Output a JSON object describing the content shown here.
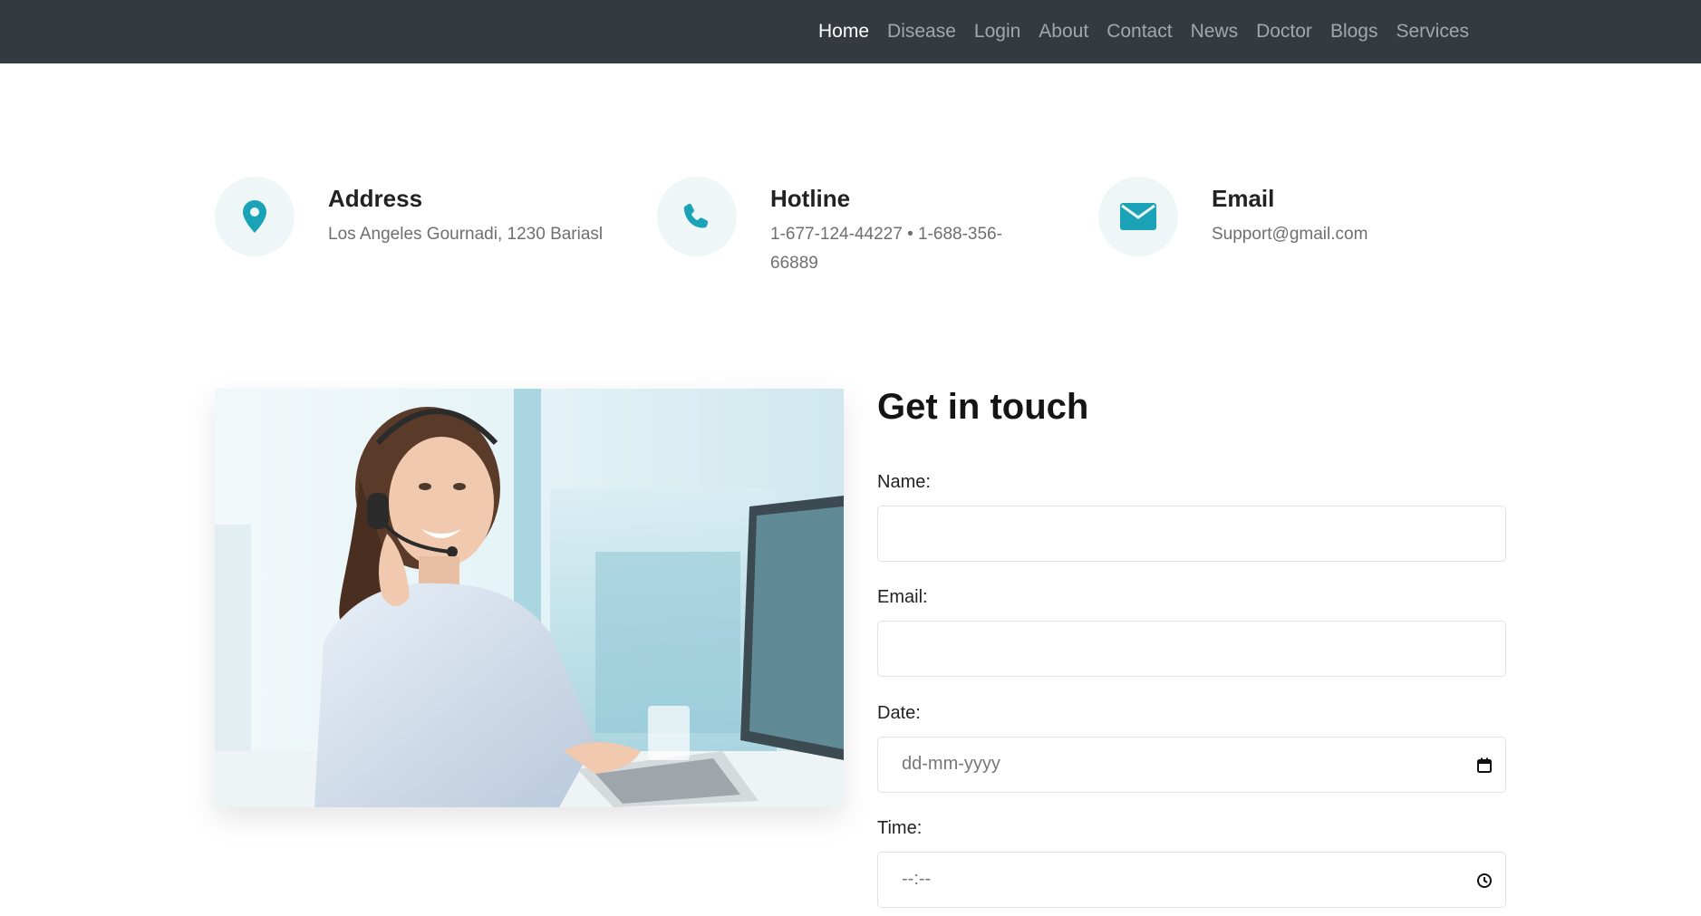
{
  "nav": {
    "items": [
      {
        "label": "Home",
        "active": true
      },
      {
        "label": "Disease",
        "active": false
      },
      {
        "label": "Login",
        "active": false
      },
      {
        "label": "About",
        "active": false
      },
      {
        "label": "Contact",
        "active": false
      },
      {
        "label": "News",
        "active": false
      },
      {
        "label": "Doctor",
        "active": false
      },
      {
        "label": "Blogs",
        "active": false
      },
      {
        "label": "Services",
        "active": false
      }
    ]
  },
  "contact_info": {
    "address": {
      "title": "Address",
      "text": "Los Angeles Gournadi, 1230 Bariasl",
      "icon": "map-pin-icon"
    },
    "hotline": {
      "title": "Hotline",
      "text": "1-677-124-44227 • 1-688-356-66889",
      "icon": "phone-icon"
    },
    "email": {
      "title": "Email",
      "text": "Support@gmail.com",
      "icon": "envelope-icon"
    }
  },
  "form": {
    "title": "Get in touch",
    "name_label": "Name:",
    "email_label": "Email:",
    "date_label": "Date:",
    "date_placeholder": "dd-mm-yyyy",
    "time_label": "Time:",
    "time_placeholder": "--:--"
  },
  "colors": {
    "navbar": "#343a40",
    "accent": "#1aa3b6",
    "icon_circle": "#eef6f7"
  }
}
